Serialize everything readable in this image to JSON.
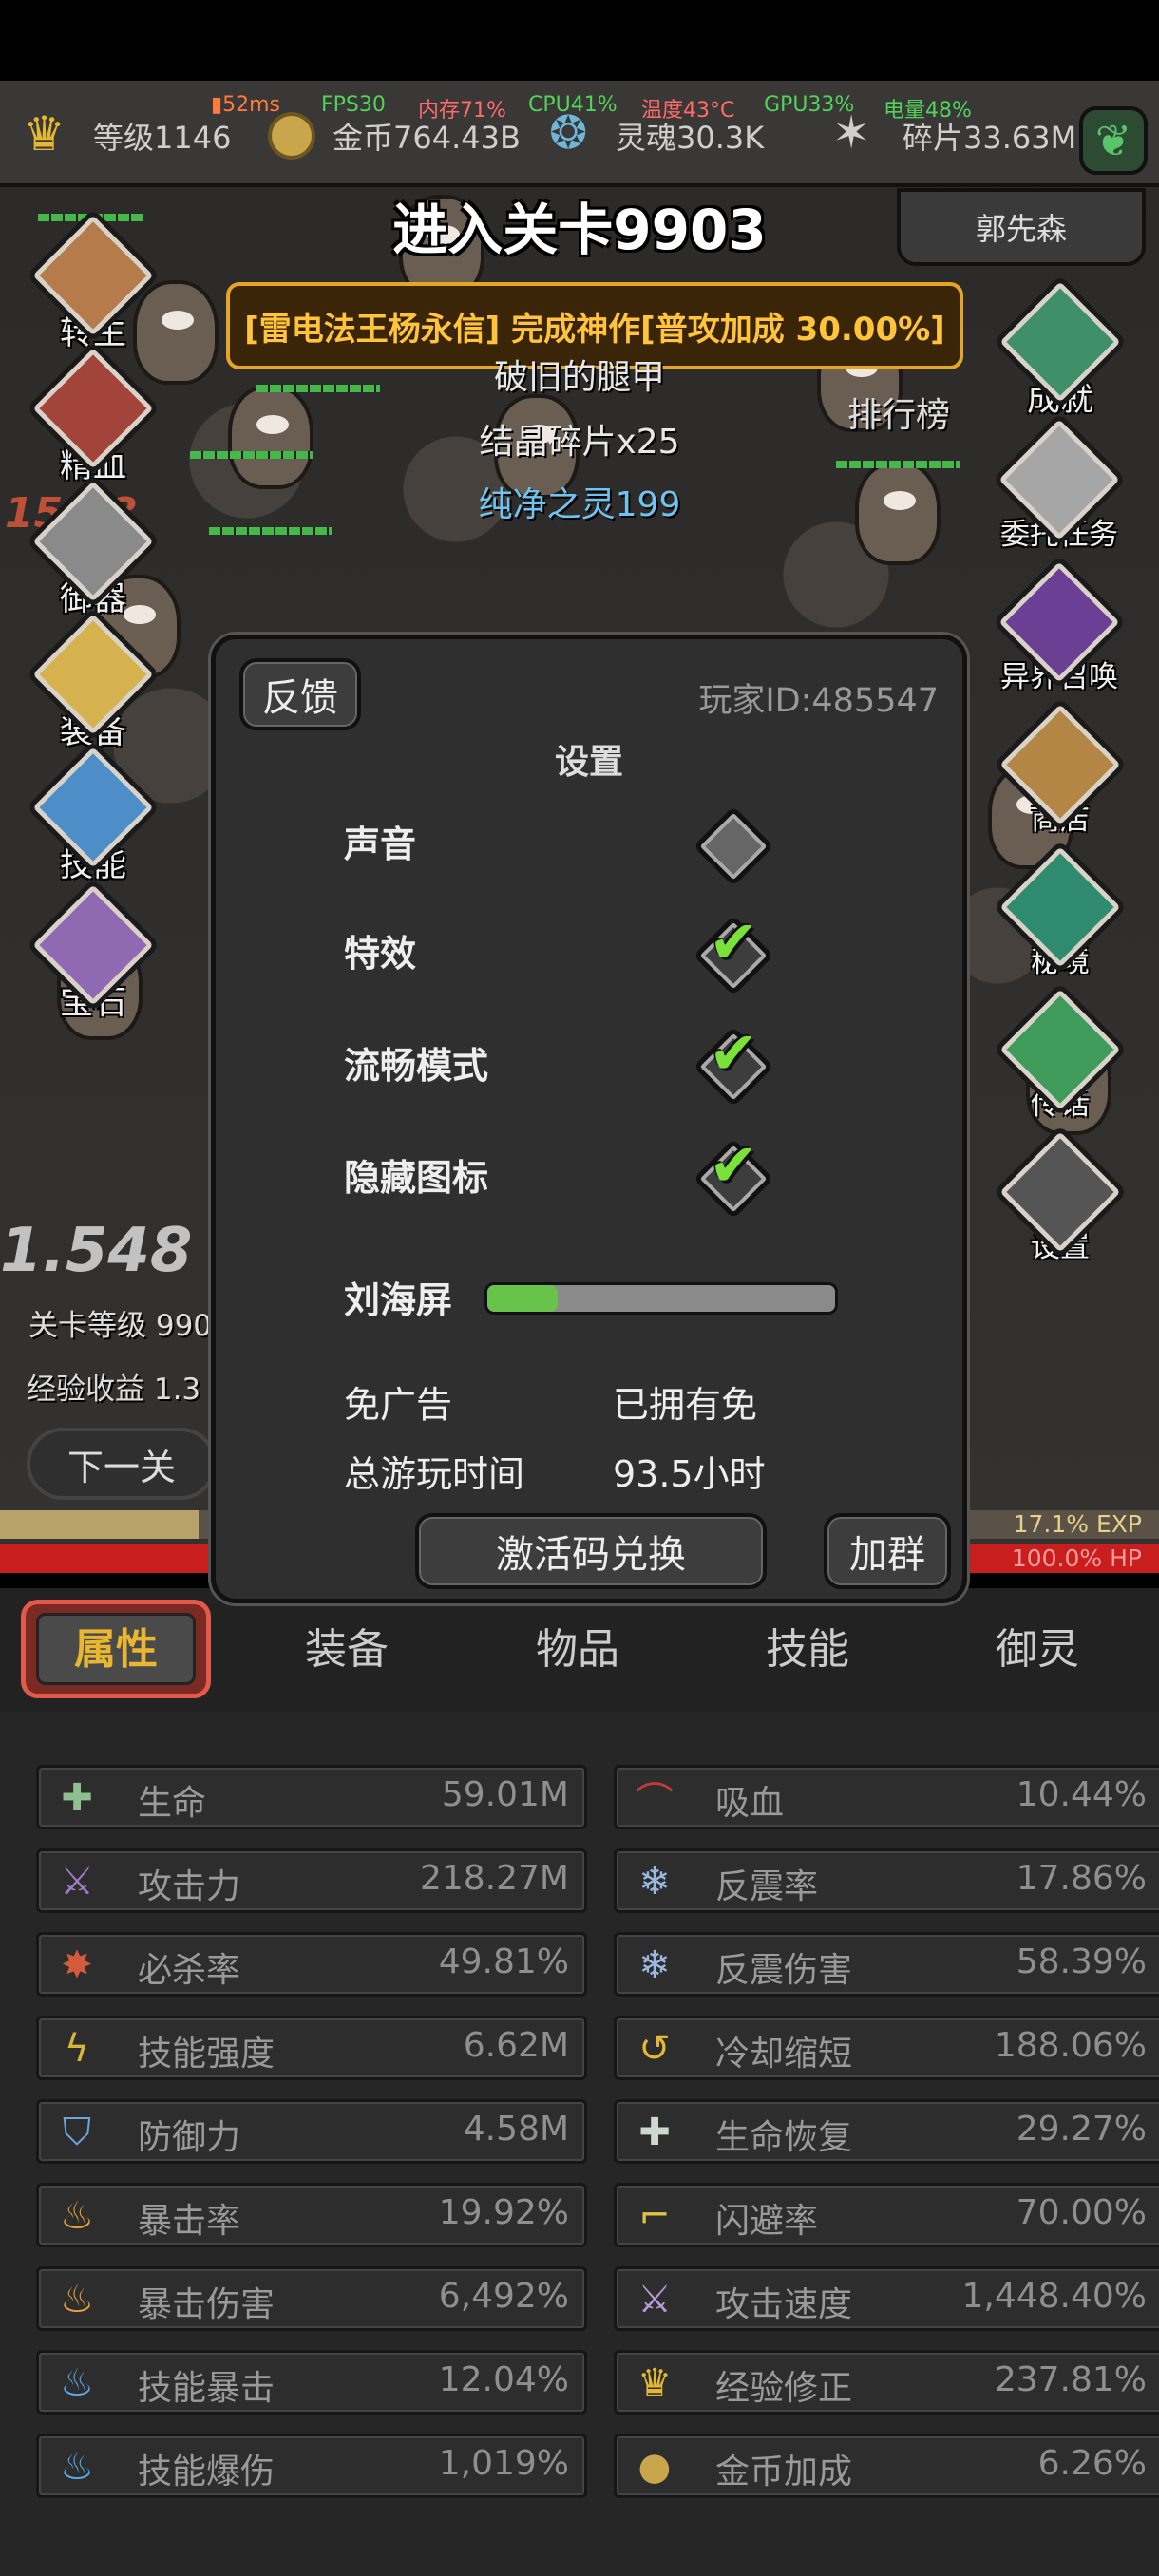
{
  "perf": {
    "ping": "52ms",
    "fps": "FPS30",
    "memory": "内存71%",
    "cpu": "CPU41%",
    "temp": "温度43°C",
    "gpu": "GPU33%",
    "battery": "电量48%"
  },
  "stats": {
    "level": "等级1146",
    "gold": "金币764.43B",
    "soul": "灵魂30.3K",
    "shards": "碎片33.63M"
  },
  "stage": {
    "title": "进入关卡9903",
    "player_name": "郭先森",
    "rank_label": "排行榜"
  },
  "notice": "[雷电法王杨永信] 完成神作[普攻加成 30.00%]",
  "drops": {
    "line1": "破旧的腿甲",
    "line2": "结晶碎片x25",
    "line3": "纯净之灵199"
  },
  "left_menu": [
    "转生",
    "精血",
    "御器",
    "装备",
    "技能",
    "宝石"
  ],
  "right_menu": [
    "成就",
    "委托任务",
    "异界召唤",
    "商店",
    "秘境",
    "传话",
    "设置"
  ],
  "battle": {
    "stage_level": "关卡等级 990",
    "exp_gain": "经验收益 1.3",
    "next_button": "下一关",
    "exp_pct": "17.1% EXP",
    "hp_pct": "100.0%  HP",
    "dmg1": "1.548",
    "dmg2": "15.48"
  },
  "settings": {
    "feedback": "反馈",
    "player_id": "玩家ID:485547",
    "title": "设置",
    "options": [
      {
        "label": "声音",
        "checked": false
      },
      {
        "label": "特效",
        "checked": true
      },
      {
        "label": "流畅模式",
        "checked": true
      },
      {
        "label": "隐藏图标",
        "checked": true
      }
    ],
    "notch_label": "刘海屏",
    "notch_value": 0.2,
    "ad_label": "免广告",
    "ad_value": "已拥有免",
    "playtime_label": "总游玩时间",
    "playtime_value": "93.5小时",
    "redeem_button": "激活码兑换",
    "group_button": "加群"
  },
  "tabs": [
    "属性",
    "装备",
    "物品",
    "技能",
    "御灵"
  ],
  "attributes_left": [
    {
      "icon": "plus-icon",
      "label": "生命",
      "value": "59.01M"
    },
    {
      "icon": "sword-icon",
      "label": "攻击力",
      "value": "218.27M"
    },
    {
      "icon": "crit-kill-icon",
      "label": "必杀率",
      "value": "49.81%"
    },
    {
      "icon": "lightning-icon",
      "label": "技能强度",
      "value": "6.62M"
    },
    {
      "icon": "shield-icon",
      "label": "防御力",
      "value": "4.58M"
    },
    {
      "icon": "flame-icon",
      "label": "暴击率",
      "value": "19.92%"
    },
    {
      "icon": "flame-icon",
      "label": "暴击伤害",
      "value": "6,492%"
    },
    {
      "icon": "blue-flame-icon",
      "label": "技能暴击",
      "value": "12.04%"
    },
    {
      "icon": "blue-flame-icon",
      "label": "技能爆伤",
      "value": "1,019%"
    }
  ],
  "attributes_right": [
    {
      "icon": "bat-icon",
      "label": "吸血",
      "value": "10.44%"
    },
    {
      "icon": "ice-shard-icon",
      "label": "反震率",
      "value": "17.86%"
    },
    {
      "icon": "ice-shard-icon",
      "label": "反震伤害",
      "value": "58.39%"
    },
    {
      "icon": "cooldown-icon",
      "label": "冷却缩短",
      "value": "188.06%"
    },
    {
      "icon": "regen-icon",
      "label": "生命恢复",
      "value": "29.27%"
    },
    {
      "icon": "boot-icon",
      "label": "闪避率",
      "value": "70.00%"
    },
    {
      "icon": "double-sword-icon",
      "label": "攻击速度",
      "value": "1,448.40%"
    },
    {
      "icon": "crown-icon",
      "label": "经验修正",
      "value": "237.81%"
    },
    {
      "icon": "coin-icon",
      "label": "金币加成",
      "value": "6.26%"
    }
  ],
  "colors": {
    "accent_gold": "#ffc43a",
    "tick_green": "#7ae03a",
    "tab_active": "#e2584a",
    "hp_red": "#c81e1e",
    "exp_gold": "#b7a36a"
  }
}
